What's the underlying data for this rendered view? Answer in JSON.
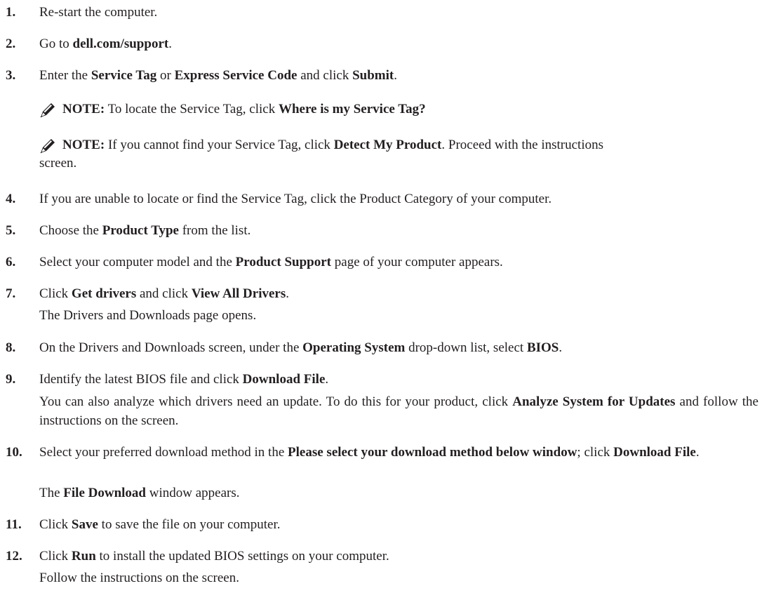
{
  "steps": [
    {
      "num": "1.",
      "parts": [
        {
          "t": "Re-start the computer."
        }
      ]
    },
    {
      "num": "2.",
      "parts": [
        {
          "t": "Go to "
        },
        {
          "b": "dell.com/support"
        },
        {
          "t": "."
        }
      ]
    },
    {
      "num": "3.",
      "parts": [
        {
          "t": "Enter the "
        },
        {
          "b": "Service Tag"
        },
        {
          "t": " or "
        },
        {
          "b": "Express Service Code"
        },
        {
          "t": " and click "
        },
        {
          "b": "Submit"
        },
        {
          "t": "."
        }
      ]
    },
    {
      "num": "4.",
      "parts": [
        {
          "t": "If you are unable to locate or find the Service Tag, click the Product Category of your computer."
        }
      ]
    },
    {
      "num": "5.",
      "parts": [
        {
          "t": "Choose the "
        },
        {
          "b": "Product Type"
        },
        {
          "t": " from the list."
        }
      ]
    },
    {
      "num": "6.",
      "parts": [
        {
          "t": "Select your computer model and the "
        },
        {
          "b": "Product Support"
        },
        {
          "t": " page of your computer appears."
        }
      ]
    },
    {
      "num": "7.",
      "parts": [
        {
          "t": "Click "
        },
        {
          "b": "Get drivers"
        },
        {
          "t": " and click "
        },
        {
          "b": "View All Drivers"
        },
        {
          "t": "."
        }
      ]
    },
    {
      "num": "8.",
      "parts": [
        {
          "t": "On the Drivers and Downloads screen, under the "
        },
        {
          "b": "Operating System"
        },
        {
          "t": " drop-down list, select "
        },
        {
          "b": "BIOS"
        },
        {
          "t": "."
        }
      ]
    },
    {
      "num": "9.",
      "parts": [
        {
          "t": "Identify the latest BIOS file and click "
        },
        {
          "b": "Download File"
        },
        {
          "t": "."
        }
      ]
    },
    {
      "num": "10.",
      "parts": [
        {
          "t": "Select your preferred download method in the "
        },
        {
          "b": "Please select your download method below window"
        },
        {
          "t": "; click "
        },
        {
          "b": "Download File"
        },
        {
          "t": "."
        }
      ]
    },
    {
      "num": "11.",
      "parts": [
        {
          "t": "Click "
        },
        {
          "b": "Save"
        },
        {
          "t": " to save the file on your computer."
        }
      ]
    },
    {
      "num": "12.",
      "parts": [
        {
          "t": "Click "
        },
        {
          "b": "Run"
        },
        {
          "t": " to install the updated BIOS settings on your computer."
        }
      ]
    }
  ],
  "notes": [
    {
      "parts": [
        {
          "b": "NOTE:"
        },
        {
          "t": " To locate the Service Tag, click "
        },
        {
          "b": "Where is my Service Tag?"
        }
      ]
    },
    {
      "parts": [
        {
          "b": "NOTE:"
        },
        {
          "t": " If you cannot find your Service Tag, click "
        },
        {
          "b": "Detect My Product"
        },
        {
          "t": ". Proceed with the instructions"
        }
      ],
      "cont": "screen."
    }
  ],
  "extras": {
    "step7": [
      {
        "t": "The Drivers and Downloads page opens."
      }
    ],
    "step9": [
      {
        "t": "You can also analyze which drivers need an update. To do this for your product, click "
      },
      {
        "b": "Analyze System for Updates"
      },
      {
        "t": " and follow the instructions on the screen."
      }
    ],
    "step10": [
      {
        "t": "The "
      },
      {
        "b": "File Download"
      },
      {
        "t": " window appears."
      }
    ],
    "step12": [
      {
        "t": "Follow the instructions on the screen."
      }
    ]
  },
  "icons": {
    "note": "note-pencil-icon"
  },
  "colors": {
    "text": "#231f20",
    "icon": "#231f20"
  }
}
